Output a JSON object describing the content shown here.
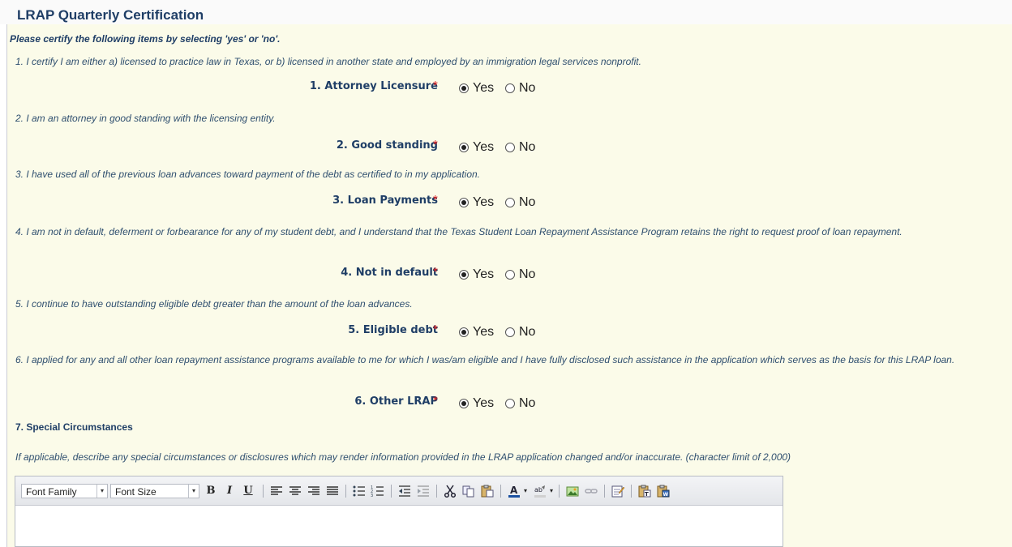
{
  "header": {
    "title": "LRAP Quarterly Certification"
  },
  "subtitle": "Please certify the following items by selecting 'yes' or 'no'.",
  "questions": [
    {
      "statement": "1. I certify I am either a) licensed to practice law in Texas, or b) licensed in another state and employed by an immigration legal services nonprofit.",
      "label": "1. Attorney Licensure",
      "required": "*",
      "yes_label": "Yes",
      "no_label": "No",
      "selected": "Yes"
    },
    {
      "statement": "2. I am an attorney in good standing with the licensing entity.",
      "label": "2. Good standing",
      "required": "*",
      "yes_label": "Yes",
      "no_label": "No",
      "selected": "Yes"
    },
    {
      "statement": "3. I have used all of the previous loan advances toward payment of the debt as certified to in my application.",
      "label": "3. Loan Payments",
      "required": "*",
      "yes_label": "Yes",
      "no_label": "No",
      "selected": "Yes"
    },
    {
      "statement": "4. I am not in default, deferment or forbearance for any of my student debt, and I understand that the Texas Student Loan Repayment Assistance Program retains the right to request proof of loan repayment.",
      "label": "4. Not in default",
      "required": "*",
      "yes_label": "Yes",
      "no_label": "No",
      "selected": "Yes"
    },
    {
      "statement": "5. I continue to have outstanding eligible debt greater than the amount of the loan advances.",
      "label": "5. Eligible debt",
      "required": "*",
      "yes_label": "Yes",
      "no_label": "No",
      "selected": "Yes"
    },
    {
      "statement": "6. I applied for any and all other loan repayment assistance programs available to me for which I was/am eligible and I have fully disclosed such assistance in the application which serves as the basis for this LRAP loan.",
      "label": "6. Other LRAP",
      "required": "*",
      "yes_label": "Yes",
      "no_label": "No",
      "selected": "Yes"
    }
  ],
  "special": {
    "heading": "7. Special Circumstances",
    "description": "If applicable, describe any special circumstances or disclosures which may render information provided in the LRAP application changed and/or inaccurate. (character limit of 2,000)"
  },
  "editor": {
    "font_family_label": "Font Family",
    "font_size_label": "Font Size",
    "bold": "B",
    "italic": "I",
    "underline": "U",
    "dropdown_arrow": "▾",
    "tools": [
      "align-left-icon",
      "align-center-icon",
      "align-right-icon",
      "align-justify-icon",
      "bullet-list-icon",
      "numbered-list-icon",
      "outdent-icon",
      "indent-icon",
      "cut-icon",
      "copy-icon",
      "paste-icon",
      "font-color-icon",
      "highlight-color-icon",
      "image-icon",
      "link-icon",
      "edit-icon",
      "paste-text-icon",
      "paste-word-icon"
    ],
    "content": ""
  },
  "colors": {
    "heading": "#1f3e66",
    "panel_bg": "#fbfbe9",
    "required": "#e02020"
  }
}
